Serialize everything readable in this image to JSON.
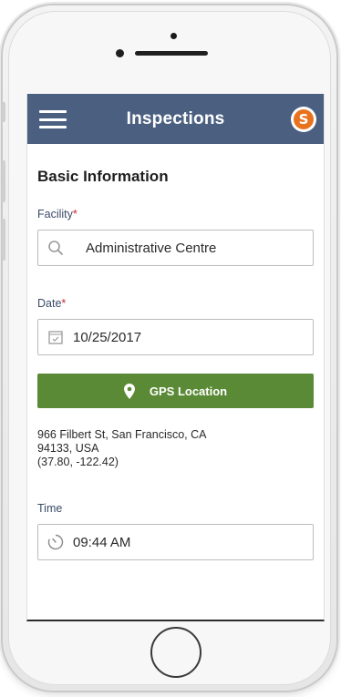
{
  "app": {
    "title": "Inspections",
    "logo_letter": "S"
  },
  "form": {
    "section_title": "Basic Information",
    "facility": {
      "label": "Facility",
      "required_mark": "*",
      "value": "Administrative Centre"
    },
    "date": {
      "label": "Date",
      "required_mark": "*",
      "value": "10/25/2017"
    },
    "gps": {
      "button_label": "GPS Location",
      "address_line1": "966 Filbert St, San Francisco, CA",
      "address_line2": "94133, USA",
      "coordinates": "(37.80, -122.42)"
    },
    "time": {
      "label": "Time",
      "value": "09:44 AM"
    }
  },
  "colors": {
    "appbar": "#4b6081",
    "gps_button": "#5b8a37",
    "required": "#c9252d",
    "label": "#3b4b68",
    "logo": "#e8731e"
  }
}
